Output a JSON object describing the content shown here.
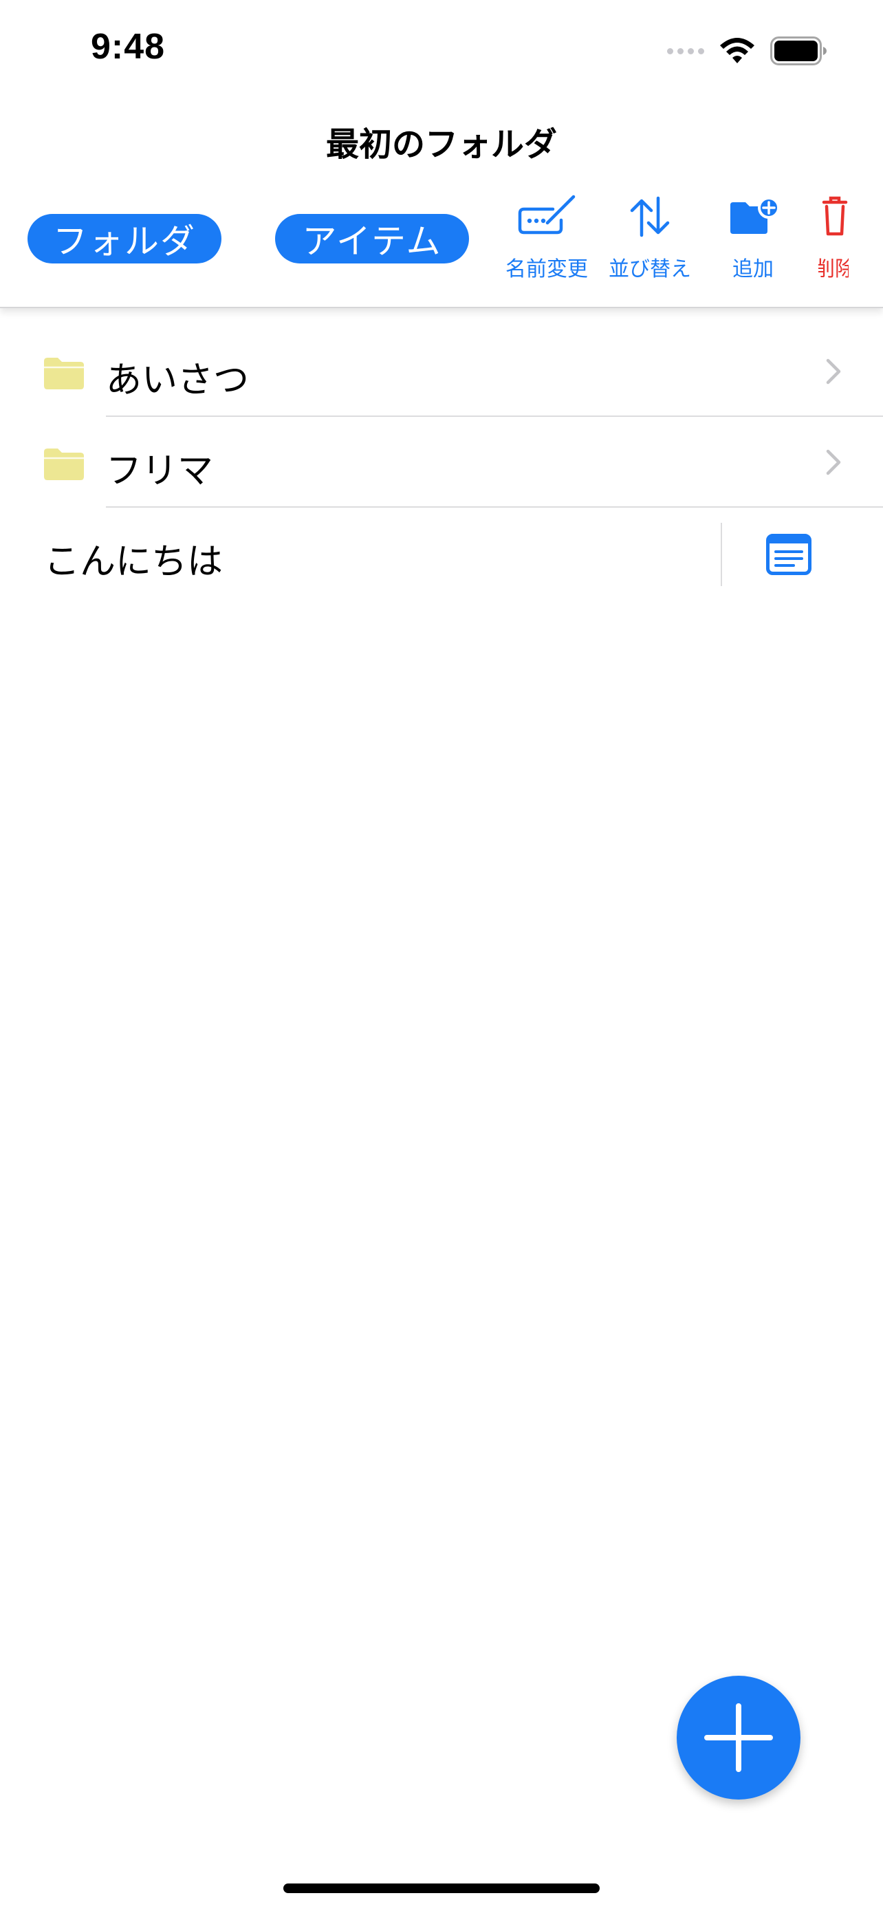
{
  "status_bar": {
    "time": "9:48",
    "icons": [
      "cellular-dots-icon",
      "wifi-icon",
      "battery-icon"
    ]
  },
  "header": {
    "title": "最初のフォルダ",
    "pills": {
      "folder_label": "フォルダ",
      "item_label": "アイテム"
    },
    "toolbar": {
      "rename_label": "名前変更",
      "sort_label": "並び替え",
      "add_label": "追加",
      "delete_label": "削除"
    }
  },
  "list": {
    "folders": [
      {
        "label": "あいさつ",
        "icon": "folder-icon"
      },
      {
        "label": "フリマ",
        "icon": "folder-icon"
      }
    ],
    "items": [
      {
        "label": "こんにちは",
        "icon": "note-icon"
      }
    ]
  },
  "colors": {
    "accent": "#1a7bf5",
    "destructive": "#e8322d",
    "folder": "#ede793",
    "separator": "#dcdcde"
  }
}
